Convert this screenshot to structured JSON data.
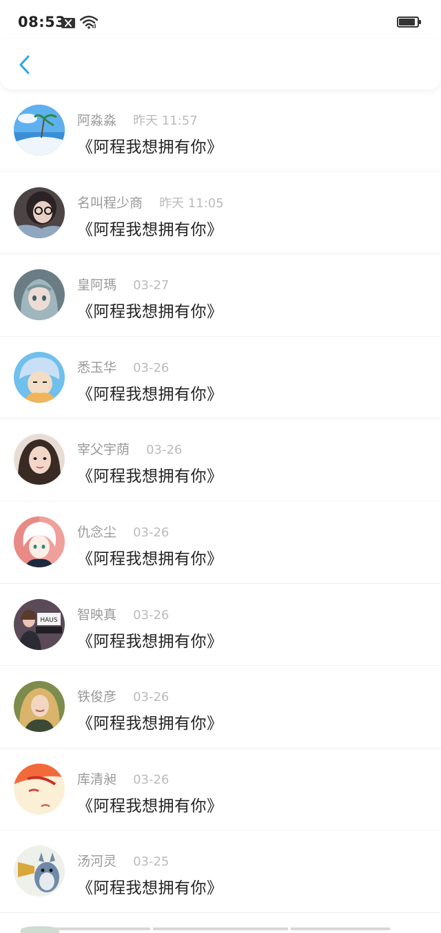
{
  "status_bar": {
    "time": "08:53",
    "battery_level": 0.9,
    "icons": [
      "notification-blocked-icon",
      "wifi-icon",
      "battery-icon"
    ]
  },
  "navbar": {
    "back_icon": "chevron-left-icon",
    "accent_color": "#2aa6e8"
  },
  "comments": [
    {
      "user": "阿淼淼",
      "time": "昨天 11:57",
      "content": "《阿程我想拥有你》"
    },
    {
      "user": "名叫程少商",
      "time": "昨天 11:05",
      "content": "《阿程我想拥有你》"
    },
    {
      "user": "皇阿瑪",
      "time": "03-27",
      "content": "《阿程我想拥有你》"
    },
    {
      "user": "悉玉华",
      "time": "03-26",
      "content": "《阿程我想拥有你》"
    },
    {
      "user": "宰父宇荫",
      "time": "03-26",
      "content": "《阿程我想拥有你》"
    },
    {
      "user": "仇念尘",
      "time": "03-26",
      "content": "《阿程我想拥有你》"
    },
    {
      "user": "智映真",
      "time": "03-26",
      "content": "《阿程我想拥有你》"
    },
    {
      "user": "铁俊彦",
      "time": "03-26",
      "content": "《阿程我想拥有你》"
    },
    {
      "user": "库清昶",
      "time": "03-26",
      "content": "《阿程我想拥有你》"
    },
    {
      "user": "汤河灵",
      "time": "03-25",
      "content": "《阿程我想拥有你》"
    }
  ],
  "avatar_text": {
    "haus": "HAUS"
  }
}
